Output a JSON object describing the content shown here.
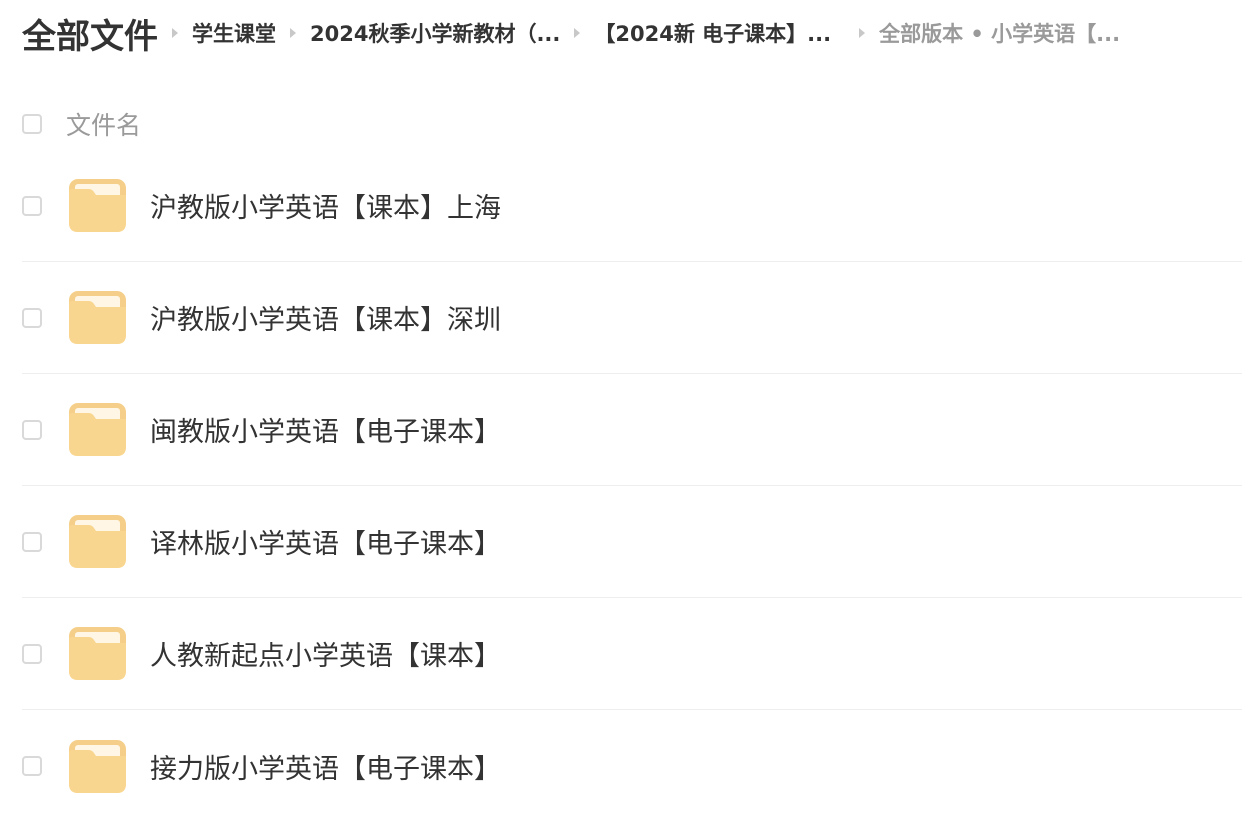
{
  "breadcrumb": {
    "root": "全部文件",
    "items": [
      "学生课堂",
      "2024秋季小学新教材（...",
      "【2024新 电子课本】...",
      "全部版本 • 小学英语【..."
    ]
  },
  "list": {
    "column_title": "文件名",
    "files": [
      {
        "name": "沪教版小学英语【课本】上海",
        "icon": "folder-icon"
      },
      {
        "name": "沪教版小学英语【课本】深圳",
        "icon": "folder-icon"
      },
      {
        "name": "闽教版小学英语【电子课本】",
        "icon": "folder-icon"
      },
      {
        "name": "译林版小学英语【电子课本】",
        "icon": "folder-icon"
      },
      {
        "name": "人教新起点小学英语【课本】",
        "icon": "folder-icon"
      },
      {
        "name": "接力版小学英语【电子课本】",
        "icon": "folder-icon"
      }
    ]
  },
  "colors": {
    "folder_back": "#f5cf8a",
    "folder_front": "#f9d68f",
    "folder_paper": "#fff6e6",
    "separator": "#eeeeee",
    "muted_text": "#9a9a9a"
  }
}
